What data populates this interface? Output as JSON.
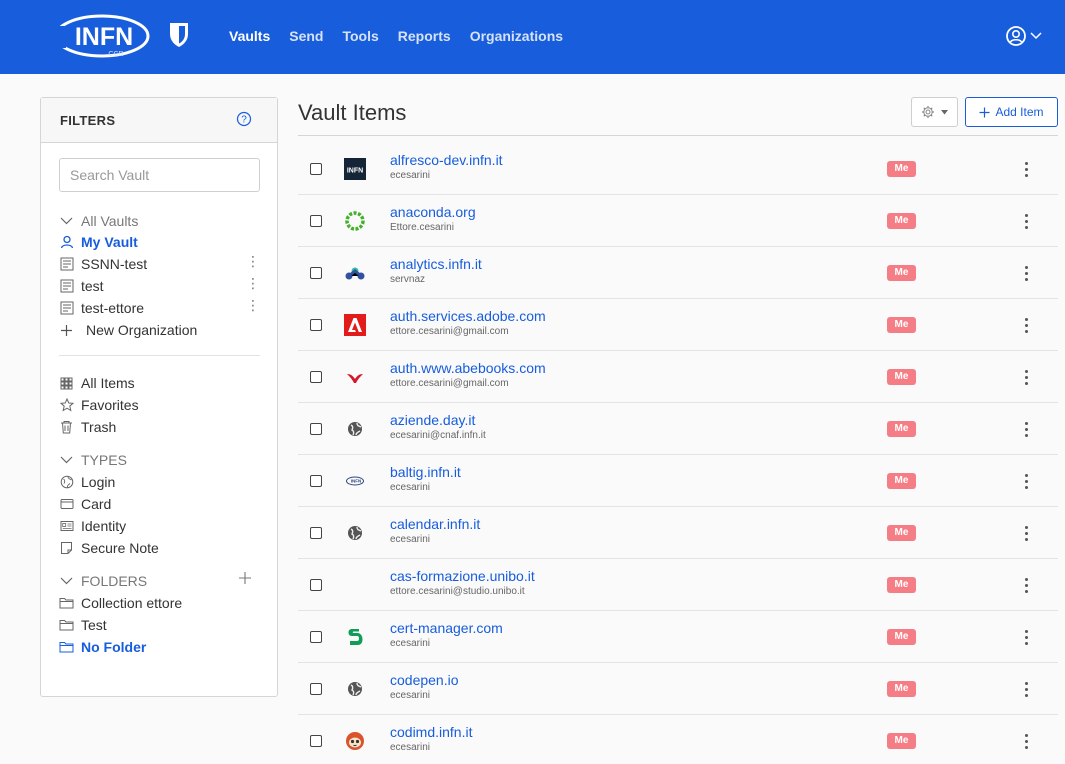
{
  "brand": {
    "logo_text": "INFN",
    "logo_sub": "CCR",
    "accent": "#175ddc",
    "badge_color": "#f57e86"
  },
  "nav": {
    "items": [
      {
        "label": "Vaults",
        "active": true
      },
      {
        "label": "Send",
        "active": false
      },
      {
        "label": "Tools",
        "active": false
      },
      {
        "label": "Reports",
        "active": false
      },
      {
        "label": "Organizations",
        "active": false
      }
    ],
    "account_icon": "account-circle-icon"
  },
  "filters": {
    "title": "FILTERS",
    "search_placeholder": "Search Vault",
    "vaults_header": "All Vaults",
    "vaults": [
      {
        "label": "My Vault",
        "icon": "user-icon",
        "selected": true
      },
      {
        "label": "SSNN-test",
        "icon": "org-icon"
      },
      {
        "label": "test",
        "icon": "org-icon"
      },
      {
        "label": "test-ettore",
        "icon": "org-icon"
      }
    ],
    "new_org_label": "New Organization",
    "collections": [
      {
        "label": "All Items",
        "icon": "grid-icon"
      },
      {
        "label": "Favorites",
        "icon": "star-icon"
      },
      {
        "label": "Trash",
        "icon": "trash-icon"
      }
    ],
    "types_header": "TYPES",
    "types": [
      {
        "label": "Login",
        "icon": "globe-icon"
      },
      {
        "label": "Card",
        "icon": "card-icon"
      },
      {
        "label": "Identity",
        "icon": "id-icon"
      },
      {
        "label": "Secure Note",
        "icon": "note-icon"
      }
    ],
    "folders_header": "FOLDERS",
    "folders": [
      {
        "label": "Collection ettore",
        "selected": false
      },
      {
        "label": "Test",
        "selected": false
      },
      {
        "label": "No Folder",
        "selected": true
      }
    ]
  },
  "main": {
    "title": "Vault Items",
    "add_item_label": "Add Item",
    "owner_badge": "Me",
    "items": [
      {
        "name": "alfresco-dev.infn.it",
        "username": "ecesarini",
        "icon": "infn-favicon"
      },
      {
        "name": "anaconda.org",
        "username": "Ettore.cesarini",
        "icon": "anaconda-favicon"
      },
      {
        "name": "analytics.infn.it",
        "username": "servnaz",
        "icon": "matomo-favicon"
      },
      {
        "name": "auth.services.adobe.com",
        "username": "ettore.cesarini@gmail.com",
        "icon": "adobe-favicon"
      },
      {
        "name": "auth.www.abebooks.com",
        "username": "ettore.cesarini@gmail.com",
        "icon": "abebooks-favicon"
      },
      {
        "name": "aziende.day.it",
        "username": "ecesarini@cnaf.infn.it",
        "icon": "globe-favicon"
      },
      {
        "name": "baltig.infn.it",
        "username": "ecesarini",
        "icon": "infn-small-favicon"
      },
      {
        "name": "calendar.infn.it",
        "username": "ecesarini",
        "icon": "globe-favicon"
      },
      {
        "name": "cas-formazione.unibo.it",
        "username": "ettore.cesarini@studio.unibo.it",
        "icon": "none"
      },
      {
        "name": "cert-manager.com",
        "username": "ecesarini",
        "icon": "certmanager-favicon"
      },
      {
        "name": "codepen.io",
        "username": "ecesarini",
        "icon": "globe-favicon"
      },
      {
        "name": "codimd.infn.it",
        "username": "ecesarini",
        "icon": "codimd-favicon"
      }
    ]
  }
}
